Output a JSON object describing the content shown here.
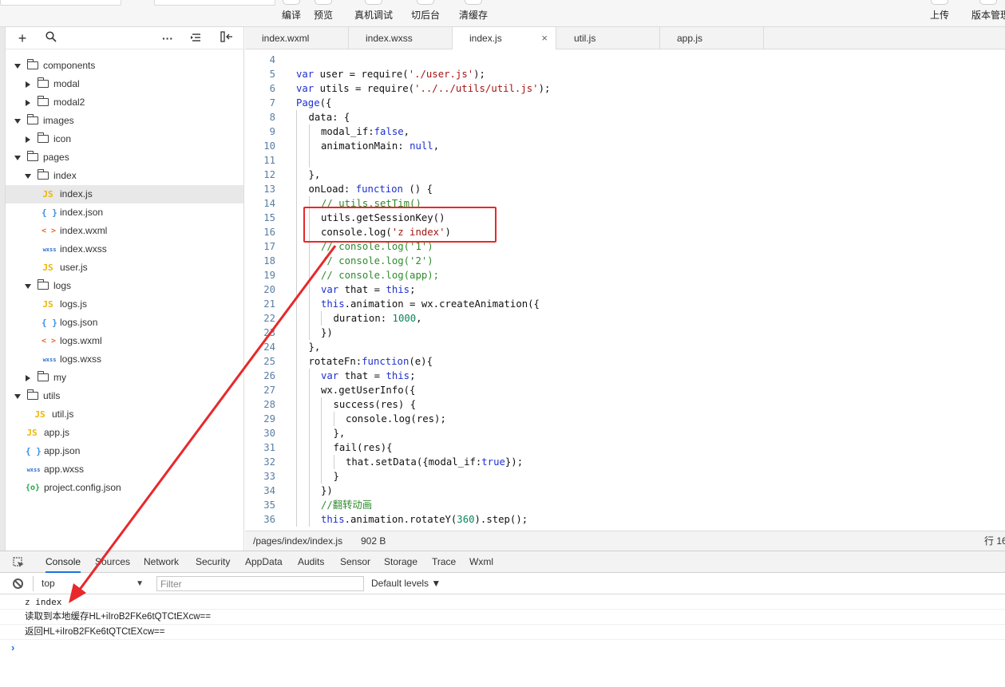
{
  "toolbar": {
    "compile": "编译",
    "preview": "预览",
    "remote_debug": "真机调试",
    "background": "切后台",
    "clear_cache": "清缓存",
    "upload": "上传",
    "version": "版本管理"
  },
  "explorer": {
    "icons": [
      "add-icon",
      "search-icon",
      "more-icon",
      "collapse-icon",
      "split-icon"
    ],
    "tree": [
      {
        "label": "components",
        "type": "folder",
        "depth": 0,
        "expanded": true
      },
      {
        "label": "modal",
        "type": "folder",
        "depth": 1,
        "expanded": false
      },
      {
        "label": "modal2",
        "type": "folder",
        "depth": 1,
        "expanded": false
      },
      {
        "label": "images",
        "type": "folder",
        "depth": 0,
        "expanded": true
      },
      {
        "label": "icon",
        "type": "folder",
        "depth": 1,
        "expanded": false
      },
      {
        "label": "pages",
        "type": "folder",
        "depth": 0,
        "expanded": true
      },
      {
        "label": "index",
        "type": "folder",
        "depth": 1,
        "expanded": true
      },
      {
        "label": "index.js",
        "type": "js",
        "depth": 2,
        "selected": true
      },
      {
        "label": "index.json",
        "type": "json",
        "depth": 2
      },
      {
        "label": "index.wxml",
        "type": "wxml",
        "depth": 2
      },
      {
        "label": "index.wxss",
        "type": "wxss",
        "depth": 2
      },
      {
        "label": "user.js",
        "type": "js",
        "depth": 2
      },
      {
        "label": "logs",
        "type": "folder",
        "depth": 1,
        "expanded": true
      },
      {
        "label": "logs.js",
        "type": "js",
        "depth": 2
      },
      {
        "label": "logs.json",
        "type": "json",
        "depth": 2
      },
      {
        "label": "logs.wxml",
        "type": "wxml",
        "depth": 2
      },
      {
        "label": "logs.wxss",
        "type": "wxss",
        "depth": 2
      },
      {
        "label": "my",
        "type": "folder",
        "depth": 1,
        "expanded": false
      },
      {
        "label": "utils",
        "type": "folder",
        "depth": 0,
        "expanded": true
      },
      {
        "label": "util.js",
        "type": "js",
        "depth": 1
      },
      {
        "label": "app.js",
        "type": "js",
        "depth": 0
      },
      {
        "label": "app.json",
        "type": "json",
        "depth": 0
      },
      {
        "label": "app.wxss",
        "type": "wxss",
        "depth": 0
      },
      {
        "label": "project.config.json",
        "type": "cfg",
        "depth": 0
      }
    ],
    "icon_text": {
      "js": "JS",
      "json": "{ }",
      "wxml": "< >",
      "wxss": "wxss",
      "cfg": "{o}"
    }
  },
  "tabs": [
    {
      "label": "index.wxml",
      "active": false
    },
    {
      "label": "index.wxss",
      "active": false
    },
    {
      "label": "index.js",
      "active": true,
      "close": "×"
    },
    {
      "label": "util.js",
      "active": false
    },
    {
      "label": "app.js",
      "active": false
    }
  ],
  "editor": {
    "lines": [
      {
        "n": "4",
        "indent": 0,
        "tokens": []
      },
      {
        "n": "5",
        "indent": 0,
        "tokens": [
          [
            "kw",
            "var"
          ],
          [
            "p",
            " user = require("
          ],
          [
            "str",
            "'./user.js'"
          ],
          [
            "p",
            ");"
          ]
        ]
      },
      {
        "n": "6",
        "indent": 0,
        "tokens": [
          [
            "kw",
            "var"
          ],
          [
            "p",
            " utils = require("
          ],
          [
            "str",
            "'../../utils/util.js'"
          ],
          [
            "p",
            ");"
          ]
        ]
      },
      {
        "n": "7",
        "indent": 0,
        "tokens": [
          [
            "kw",
            "Page"
          ],
          [
            "p",
            "({"
          ]
        ]
      },
      {
        "n": "8",
        "indent": 1,
        "tokens": [
          [
            "p",
            "data: {"
          ]
        ]
      },
      {
        "n": "9",
        "indent": 2,
        "tokens": [
          [
            "p",
            "modal_if:"
          ],
          [
            "bool",
            "false"
          ],
          [
            "p",
            ","
          ]
        ]
      },
      {
        "n": "10",
        "indent": 2,
        "tokens": [
          [
            "p",
            "animationMain: "
          ],
          [
            "bool",
            "null"
          ],
          [
            "p",
            ","
          ]
        ]
      },
      {
        "n": "11",
        "indent": 2,
        "tokens": []
      },
      {
        "n": "12",
        "indent": 1,
        "tokens": [
          [
            "p",
            "},"
          ]
        ]
      },
      {
        "n": "13",
        "indent": 1,
        "tokens": [
          [
            "p",
            "onLoad: "
          ],
          [
            "kw",
            "function"
          ],
          [
            "p",
            " () {"
          ]
        ]
      },
      {
        "n": "14",
        "indent": 2,
        "tokens": [
          [
            "com",
            "// utils.setTim()"
          ]
        ]
      },
      {
        "n": "15",
        "indent": 2,
        "tokens": [
          [
            "p",
            "utils.getSessionKey()"
          ]
        ]
      },
      {
        "n": "16",
        "indent": 2,
        "tokens": [
          [
            "p",
            "console.log("
          ],
          [
            "str",
            "'z index'"
          ],
          [
            "p",
            ")"
          ]
        ]
      },
      {
        "n": "17",
        "indent": 2,
        "tokens": [
          [
            "com",
            "// console.log('1')"
          ]
        ]
      },
      {
        "n": "18",
        "indent": 2,
        "tokens": [
          [
            "com",
            "// console.log('2')"
          ]
        ]
      },
      {
        "n": "19",
        "indent": 2,
        "tokens": [
          [
            "com",
            "// console.log(app);"
          ]
        ]
      },
      {
        "n": "20",
        "indent": 2,
        "tokens": [
          [
            "kw",
            "var"
          ],
          [
            "p",
            " that = "
          ],
          [
            "kw",
            "this"
          ],
          [
            "p",
            ";"
          ]
        ]
      },
      {
        "n": "21",
        "indent": 2,
        "tokens": [
          [
            "kw",
            "this"
          ],
          [
            "p",
            ".animation = wx.createAnimation({"
          ]
        ]
      },
      {
        "n": "22",
        "indent": 3,
        "tokens": [
          [
            "p",
            "duration: "
          ],
          [
            "num",
            "1000"
          ],
          [
            "p",
            ","
          ]
        ]
      },
      {
        "n": "23",
        "indent": 2,
        "tokens": [
          [
            "p",
            "})"
          ]
        ]
      },
      {
        "n": "24",
        "indent": 1,
        "tokens": [
          [
            "p",
            "},"
          ]
        ]
      },
      {
        "n": "25",
        "indent": 1,
        "tokens": [
          [
            "p",
            "rotateFn:"
          ],
          [
            "kw",
            "function"
          ],
          [
            "p",
            "(e){"
          ]
        ]
      },
      {
        "n": "26",
        "indent": 2,
        "tokens": [
          [
            "kw",
            "var"
          ],
          [
            "p",
            " that = "
          ],
          [
            "kw",
            "this"
          ],
          [
            "p",
            ";"
          ]
        ]
      },
      {
        "n": "27",
        "indent": 2,
        "tokens": [
          [
            "p",
            "wx.getUserInfo({"
          ]
        ]
      },
      {
        "n": "28",
        "indent": 3,
        "tokens": [
          [
            "p",
            "success(res) {"
          ]
        ]
      },
      {
        "n": "29",
        "indent": 4,
        "tokens": [
          [
            "p",
            "console.log(res);"
          ]
        ]
      },
      {
        "n": "30",
        "indent": 3,
        "tokens": [
          [
            "p",
            "},"
          ]
        ]
      },
      {
        "n": "31",
        "indent": 3,
        "tokens": [
          [
            "p",
            "fail(res){"
          ]
        ]
      },
      {
        "n": "32",
        "indent": 4,
        "tokens": [
          [
            "p",
            "that.setData({modal_if:"
          ],
          [
            "bool",
            "true"
          ],
          [
            "p",
            "});"
          ]
        ]
      },
      {
        "n": "33",
        "indent": 3,
        "tokens": [
          [
            "p",
            "}"
          ]
        ]
      },
      {
        "n": "34",
        "indent": 2,
        "tokens": [
          [
            "p",
            "})"
          ]
        ]
      },
      {
        "n": "35",
        "indent": 2,
        "tokens": [
          [
            "com",
            "//翻转动画"
          ]
        ]
      },
      {
        "n": "36",
        "indent": 2,
        "tokens": [
          [
            "kw",
            "this"
          ],
          [
            "p",
            ".animation.rotateY("
          ],
          [
            "num",
            "360"
          ],
          [
            "p",
            ").step();"
          ]
        ]
      }
    ]
  },
  "statusbar": {
    "path": "/pages/index/index.js",
    "size": "902 B",
    "position": "行 16"
  },
  "devtools": {
    "tabs": [
      {
        "label": "Console",
        "active": true
      },
      {
        "label": "Sources",
        "active": false
      },
      {
        "label": "Network",
        "active": false
      },
      {
        "label": "Security",
        "active": false
      },
      {
        "label": "AppData",
        "active": false
      },
      {
        "label": "Audits",
        "active": false
      },
      {
        "label": "Sensor",
        "active": false
      },
      {
        "label": "Storage",
        "active": false
      },
      {
        "label": "Trace",
        "active": false
      },
      {
        "label": "Wxml",
        "active": false
      }
    ],
    "context": "top",
    "filter_placeholder": "Filter",
    "levels": "Default levels ▼",
    "console_lines": [
      {
        "text": "z index",
        "mono": true
      },
      {
        "text": "读取到本地缓存HL+iIroB2FKe6tQTCtEXcw==",
        "mono": false
      },
      {
        "text": "返回HL+iIroB2FKe6tQTCtEXcw==",
        "mono": false
      }
    ],
    "prompt": "›"
  },
  "colors": {
    "annotation_red": "#e8282b",
    "keyword": "#1f2fcf",
    "string": "#a31515",
    "comment": "#2e8b2e",
    "number": "#098658"
  }
}
